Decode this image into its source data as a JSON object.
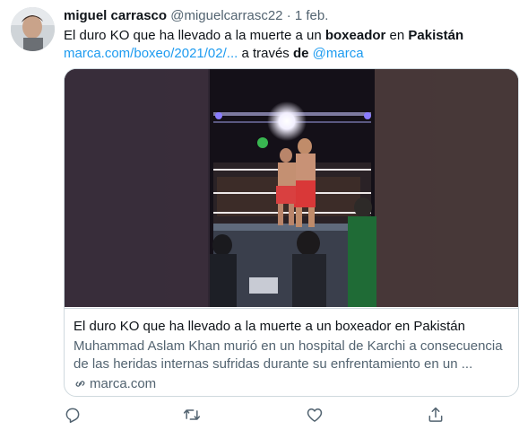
{
  "author": {
    "name": "miguel carrasco",
    "handle": "@miguelcarrasc22",
    "separator": "·",
    "time": "1 feb."
  },
  "tweet": {
    "part1": "El duro KO que ha llevado a la muerte a un ",
    "bold1": "boxeador",
    "part2": " en ",
    "bold2": "Pakistán",
    "url": "marca.com/boxeo/2021/02/...",
    "via": " a través ",
    "via_bold": "de",
    "mention": "@marca"
  },
  "card": {
    "title": "El duro KO que ha llevado a la muerte a un boxeador en Pakistán",
    "description": "Muhammad Aslam Khan murió en un hospital de Karchi a consecuencia de las heridas internas sufridas durante su enfrentamiento en un ...",
    "domain": "marca.com"
  },
  "icons": {
    "reply": "reply-icon",
    "retweet": "retweet-icon",
    "like": "like-icon",
    "share": "share-icon",
    "link": "link-icon"
  },
  "colors": {
    "link": "#1d9bf0",
    "secondary_text": "#536471",
    "border": "#cfd9de"
  }
}
